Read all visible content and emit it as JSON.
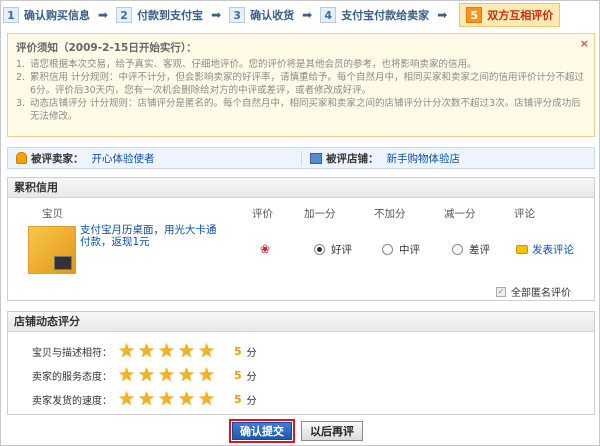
{
  "steps": [
    {
      "num": "1",
      "label": "确认购买信息"
    },
    {
      "num": "2",
      "label": "付款到支付宝"
    },
    {
      "num": "3",
      "label": "确认收货"
    },
    {
      "num": "4",
      "label": "支付宝付款给卖家"
    },
    {
      "num": "5",
      "label": "双方互相评价"
    }
  ],
  "notice": {
    "title": "评价须知（2009-2-15日开始实行）：",
    "close": "×",
    "items": [
      {
        "idx": "1.",
        "text": "请您根据本次交易，给予真实、客观、仔细地评价。您的评价将是其他会员的参考，也将影响卖家的信用。"
      },
      {
        "idx": "2.",
        "text": "累积信用 计分规则：中评不计分，但会影响卖家的好评率，请慎重给予。每个自然月中，相同买家和卖家之间的信用评价计分不超过6分。评价后30天内，您有一次机会删除给对方的中评或差评，或者修改成好评。"
      },
      {
        "idx": "3.",
        "text": "动态店铺评分 计分规则：店铺评分是匿名的。每个自然月中，相同买家和卖家之间的店铺评分计分次数不超过3次。店铺评分成功后无法修改。"
      }
    ]
  },
  "seller": {
    "seller_label": "被评卖家：",
    "seller_name": "开心体验使者",
    "shop_label": "被评店铺：",
    "shop_name": "新手购物体验店"
  },
  "credit": {
    "title": "累积信用",
    "headers": {
      "item": "宝贝",
      "rating": "评价",
      "plus": "加一分",
      "zero": "不加分",
      "minus": "减一分",
      "comment": "评论"
    },
    "item_title": "支付宝月历桌面，用光大卡通付款，返现1元",
    "options": [
      {
        "label": "好评",
        "selected": true
      },
      {
        "label": "中评",
        "selected": false
      },
      {
        "label": "差评",
        "selected": false
      }
    ],
    "comment_link": "发表评论",
    "anonymous_label": "全部匿名评价",
    "anonymous_checked": true
  },
  "shop_rating": {
    "title": "店铺动态评分",
    "rows": [
      {
        "label": "宝贝与描述相符：",
        "score": "5",
        "unit": "分",
        "stars": 5
      },
      {
        "label": "卖家的服务态度：",
        "score": "5",
        "unit": "分",
        "stars": 5
      },
      {
        "label": "卖家发货的速度：",
        "score": "5",
        "unit": "分",
        "stars": 5
      }
    ]
  },
  "buttons": {
    "confirm": "确认提交",
    "later": "以后再评"
  },
  "colors": {
    "accent": "#f7941d",
    "link": "#0a4fa8",
    "highlight_border": "#e0141e",
    "star": "#f3b41b"
  }
}
